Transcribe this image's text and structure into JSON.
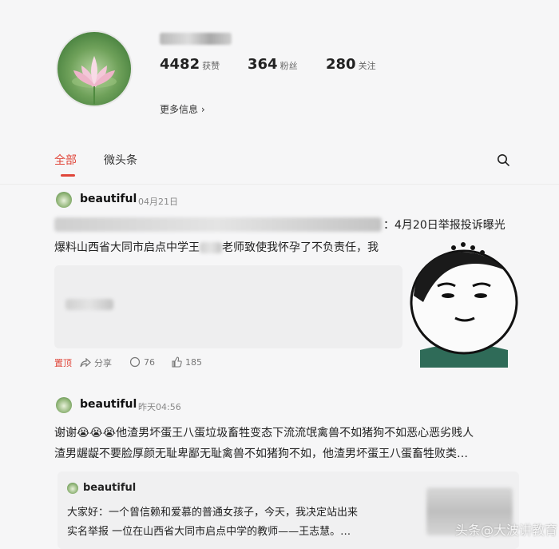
{
  "profile": {
    "stats": [
      {
        "value": "4482",
        "label": "获赞"
      },
      {
        "value": "364",
        "label": "粉丝"
      },
      {
        "value": "280",
        "label": "关注"
      }
    ],
    "more_info": "更多信息 ›"
  },
  "tabs": [
    {
      "label": "全部",
      "active": true
    },
    {
      "label": "微头条",
      "active": false
    }
  ],
  "post1": {
    "author": "beautiful",
    "time": "04月21日",
    "line1": "：4月20日举报投诉曝光",
    "line2": "爆料山西省大同市启点中学王",
    "line2b": "老师致使我怀孕了不负责任，我",
    "actions": {
      "pin": "置顶",
      "share": "分享",
      "comments": "76",
      "likes": "185"
    }
  },
  "post2": {
    "author": "beautiful",
    "time": "昨天04:56",
    "line1": "谢谢😭😭😭他渣男坏蛋王八蛋垃圾畜牲变态下流流氓禽兽不如猪狗不如恶心恶劣贱人",
    "line2": "渣男龌龊不要脸厚颜无耻卑鄙无耻禽兽不如猪狗不如，他渣男坏蛋王八蛋畜牲败类…",
    "quote": {
      "author": "beautiful",
      "line1": "大家好：一个曾信赖和爱慕的普通女孩子，今天，我决定站出来",
      "line2": "实名举报 一位在山西省大同市启点中学的教师——王志慧。…"
    }
  },
  "watermark": "头条@大波讲教育",
  "colors": {
    "accent": "#e0463a",
    "background": "#f6f6f7"
  }
}
